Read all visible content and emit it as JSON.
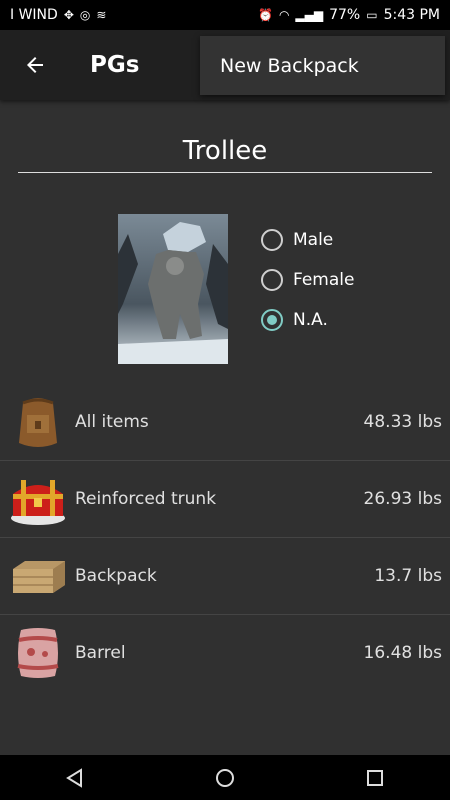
{
  "status": {
    "carrier": "I WIND",
    "battery": "77%",
    "time": "5:43 PM"
  },
  "appbar": {
    "title": "PGs"
  },
  "menu": {
    "item": "New Backpack"
  },
  "character": {
    "name": "Trollee",
    "genders": [
      "Male",
      "Female",
      "N.A."
    ],
    "selected": "N.A."
  },
  "items": [
    {
      "label": "All items",
      "weight": "48.33 lbs",
      "icon": "backpack-icon"
    },
    {
      "label": "Reinforced trunk",
      "weight": "26.93 lbs",
      "icon": "trunk-icon"
    },
    {
      "label": "Backpack",
      "weight": "13.7 lbs",
      "icon": "crate-icon"
    },
    {
      "label": "Barrel",
      "weight": "16.48 lbs",
      "icon": "barrel-icon"
    }
  ],
  "colors": {
    "accent": "#80cbc4",
    "background": "#303030",
    "appbar": "#202020"
  }
}
